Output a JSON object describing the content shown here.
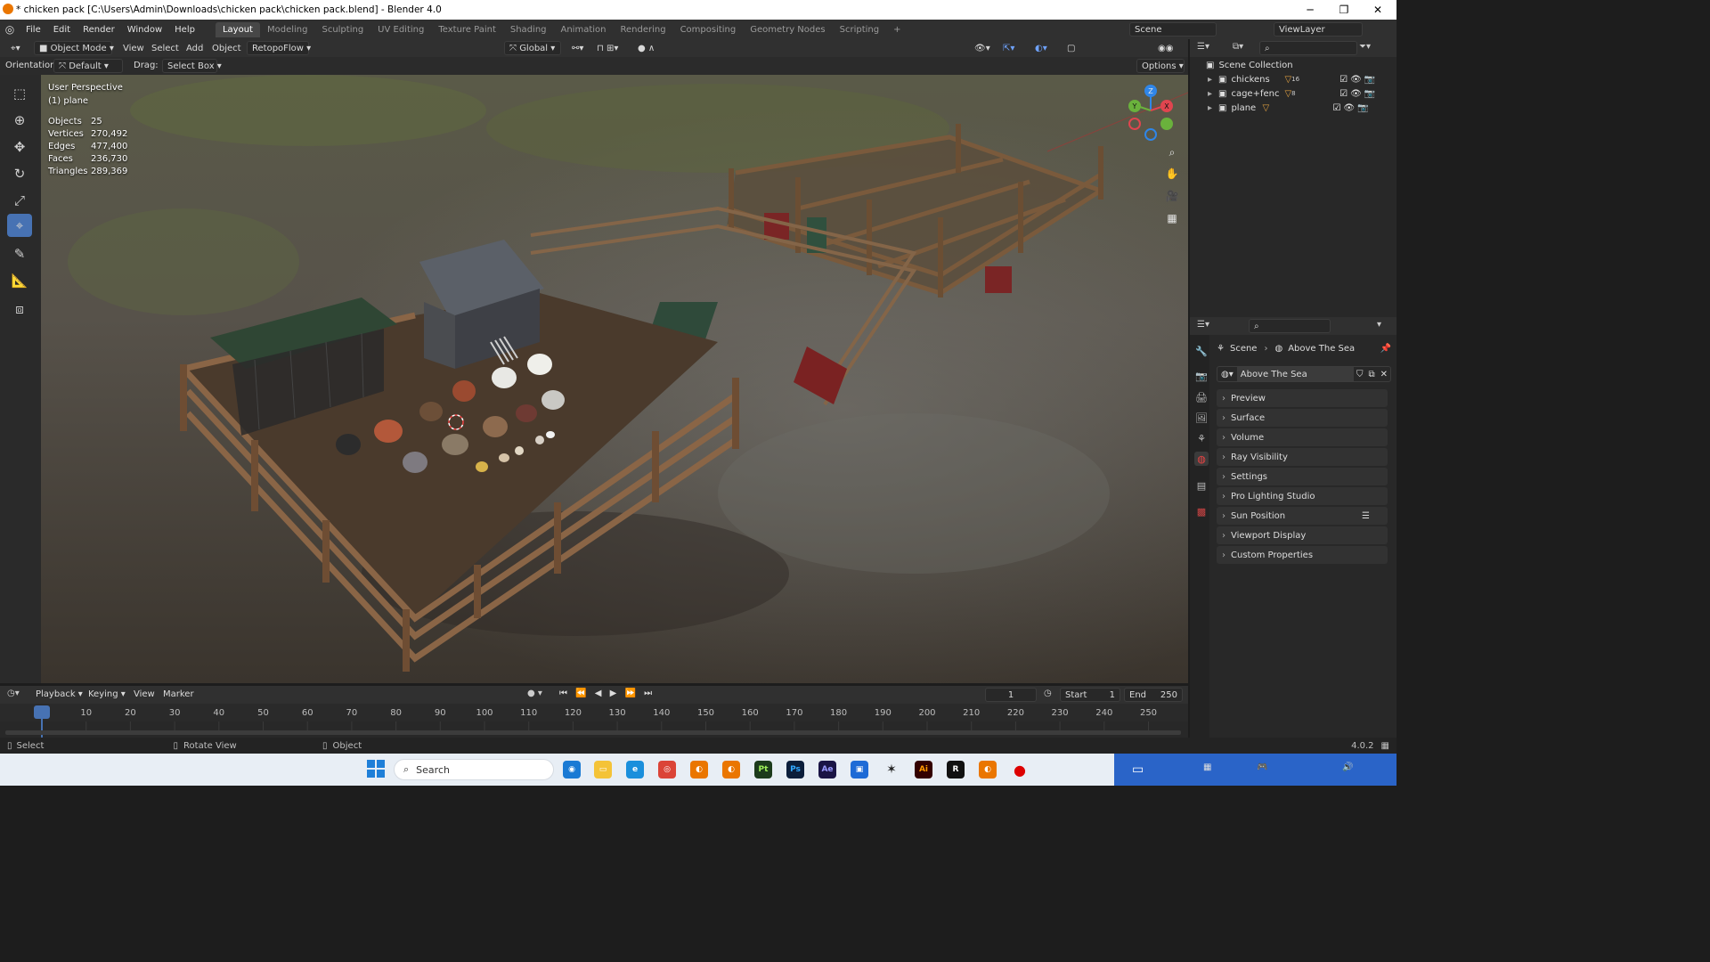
{
  "window": {
    "title": "* chicken pack [C:\\Users\\Admin\\Downloads\\chicken pack\\chicken pack.blend] - Blender 4.0",
    "minimize": "─",
    "maximize": "❐",
    "close": "✕"
  },
  "menu": [
    "File",
    "Edit",
    "Render",
    "Window",
    "Help"
  ],
  "workspaces": [
    "Layout",
    "Modeling",
    "Sculpting",
    "UV Editing",
    "Texture Paint",
    "Shading",
    "Animation",
    "Rendering",
    "Compositing",
    "Geometry Nodes",
    "Scripting",
    "+"
  ],
  "active_workspace": "Layout",
  "scene_field": "Scene",
  "viewlayer_field": "ViewLayer",
  "viewport_header": {
    "mode": "Object Mode",
    "menus": [
      "View",
      "Select",
      "Add",
      "Object"
    ],
    "addon": "RetopoFlow",
    "transform_orientation": "Global",
    "options": "Options"
  },
  "tool_header": {
    "orientation_label": "Orientation:",
    "orientation_value": "Default",
    "drag_label": "Drag:",
    "drag_value": "Select Box"
  },
  "viewport_overlay": {
    "perspective": "User Perspective",
    "active_object": "(1) plane",
    "stats": [
      {
        "label": "Objects",
        "value": "25"
      },
      {
        "label": "Vertices",
        "value": "270,492"
      },
      {
        "label": "Edges",
        "value": "477,400"
      },
      {
        "label": "Faces",
        "value": "236,730"
      },
      {
        "label": "Triangles",
        "value": "289,369"
      }
    ],
    "gizmo_axes": {
      "z": "Z",
      "y": "Y",
      "x": "X"
    }
  },
  "outliner": {
    "root": "Scene Collection",
    "items": [
      {
        "name": "chickens",
        "badge": "16"
      },
      {
        "name": "cage+fenc",
        "badge": "8"
      },
      {
        "name": "plane",
        "badge": ""
      }
    ]
  },
  "properties": {
    "breadcrumb_scene": "Scene",
    "breadcrumb_world": "Above The Sea",
    "world_name": "Above The Sea",
    "panels": [
      "Preview",
      "Surface",
      "Volume",
      "Ray Visibility",
      "Settings",
      "Pro Lighting Studio",
      "Sun Position",
      "Viewport Display",
      "Custom Properties"
    ]
  },
  "timeline": {
    "menus": [
      "Playback",
      "Keying",
      "View",
      "Marker"
    ],
    "current_frame": "1",
    "start_label": "Start",
    "start_value": "1",
    "end_label": "End",
    "end_value": "250",
    "ruler": [
      "1",
      "10",
      "20",
      "30",
      "40",
      "50",
      "60",
      "70",
      "80",
      "90",
      "100",
      "110",
      "120",
      "130",
      "140",
      "150",
      "160",
      "170",
      "180",
      "190",
      "200",
      "210",
      "220",
      "230",
      "240",
      "250"
    ]
  },
  "statusbar": {
    "select": "Select",
    "rotate": "Rotate View",
    "object": "Object",
    "version": "4.0.2"
  },
  "taskbar": {
    "search_placeholder": "Search",
    "apps": [
      "Pt",
      "Ps",
      "Ae",
      "Ai"
    ]
  },
  "colors": {
    "accent": "#4772b3",
    "axis_x": "#e0454f",
    "axis_y": "#6ab23c",
    "axis_z": "#2f86e8"
  }
}
